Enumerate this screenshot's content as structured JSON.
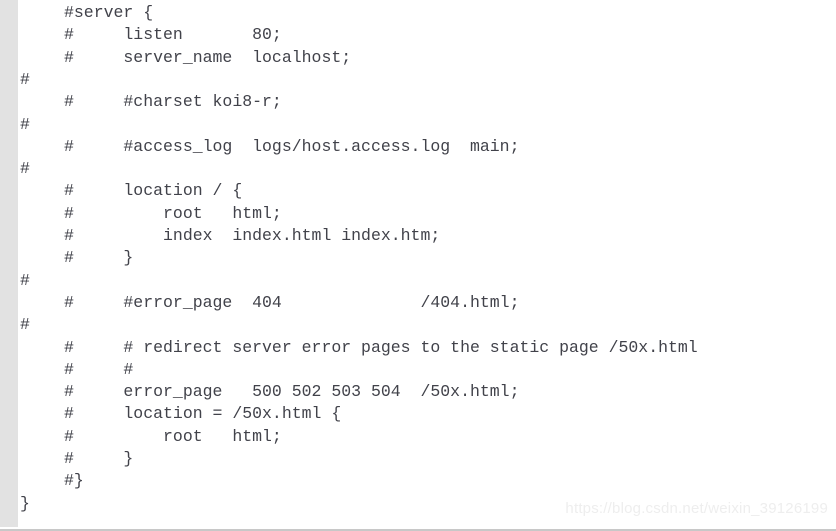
{
  "editor": {
    "language": "nginx-conf",
    "gutter_marker": "#",
    "colors": {
      "background": "#ffffff",
      "gutter": "#e2e2e2",
      "text": "#41424a",
      "watermark": "#eeeeee",
      "bottom_border": "#c8c8c8"
    },
    "lines": [
      {
        "margin": "",
        "text": "#server {",
        "indented": true
      },
      {
        "margin": "",
        "text": "#     listen       80;",
        "indented": true
      },
      {
        "margin": "",
        "text": "#     server_name  localhost;",
        "indented": true
      },
      {
        "margin": "#",
        "text": "",
        "indented": true
      },
      {
        "margin": "",
        "text": "#     #charset koi8-r;",
        "indented": true
      },
      {
        "margin": "#",
        "text": "",
        "indented": true
      },
      {
        "margin": "",
        "text": "#     #access_log  logs/host.access.log  main;",
        "indented": true
      },
      {
        "margin": "#",
        "text": "",
        "indented": true
      },
      {
        "margin": "",
        "text": "#     location / {",
        "indented": true
      },
      {
        "margin": "",
        "text": "#         root   html;",
        "indented": true
      },
      {
        "margin": "",
        "text": "#         index  index.html index.htm;",
        "indented": true
      },
      {
        "margin": "",
        "text": "#     }",
        "indented": true
      },
      {
        "margin": "#",
        "text": "",
        "indented": true
      },
      {
        "margin": "",
        "text": "#     #error_page  404              /404.html;",
        "indented": true
      },
      {
        "margin": "#",
        "text": "",
        "indented": true
      },
      {
        "margin": "",
        "text": "#     # redirect server error pages to the static page /50x.html",
        "indented": true
      },
      {
        "margin": "",
        "text": "#     #",
        "indented": true
      },
      {
        "margin": "",
        "text": "#     error_page   500 502 503 504  /50x.html;",
        "indented": true
      },
      {
        "margin": "",
        "text": "#     location = /50x.html {",
        "indented": true
      },
      {
        "margin": "",
        "text": "#         root   html;",
        "indented": true
      },
      {
        "margin": "",
        "text": "#     }",
        "indented": true
      },
      {
        "margin": "",
        "text": "#}",
        "indented": true
      },
      {
        "margin": "",
        "text": "}",
        "indented": false
      }
    ]
  },
  "watermark": {
    "text": "https://blog.csdn.net/weixin_39126199"
  }
}
